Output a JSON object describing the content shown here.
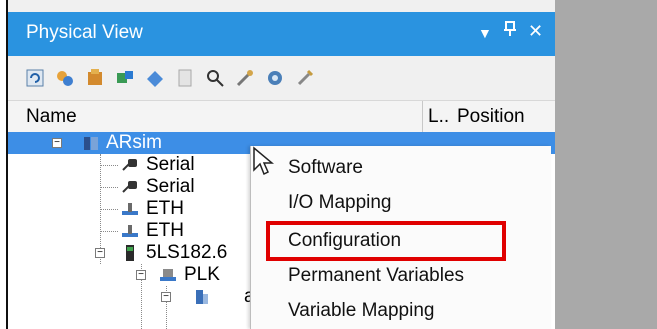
{
  "panel": {
    "title": "Physical View",
    "controls": {
      "dropdown": "▼",
      "pin": "⊕",
      "close": "✕"
    }
  },
  "toolbar": {
    "icons": [
      "refresh-icon",
      "network-icon",
      "module-icon",
      "hardware-icon",
      "search-plc-icon",
      "page-icon",
      "magnifier-icon",
      "tools-icon",
      "settings-gear-icon",
      "wrench-icon"
    ]
  },
  "columns": {
    "name": "Name",
    "l": "L..",
    "position": "Position"
  },
  "tree": {
    "root": {
      "label": "ARsim",
      "expander": "−"
    },
    "children": [
      {
        "label": "Serial",
        "icon": "serial-port-icon"
      },
      {
        "label": "Serial",
        "icon": "serial-port-icon"
      },
      {
        "label": "ETH",
        "icon": "ethernet-icon"
      },
      {
        "label": "ETH",
        "icon": "ethernet-icon"
      },
      {
        "label": "5LS182.6",
        "icon": "card-module-icon",
        "expander": "−"
      },
      {
        "label": "PLK",
        "icon": "powerlink-icon",
        "expander": "−"
      },
      {
        "label": "a",
        "icon": "drive-icon",
        "expander": "−"
      }
    ]
  },
  "context_menu": {
    "items": [
      "Software",
      "I/O Mapping",
      "Configuration",
      "Permanent Variables",
      "Variable Mapping"
    ],
    "highlighted": "Configuration"
  },
  "colors": {
    "title_bar": "#2a93e0",
    "selection": "#3d8ee6",
    "highlight_box": "#e00000"
  }
}
